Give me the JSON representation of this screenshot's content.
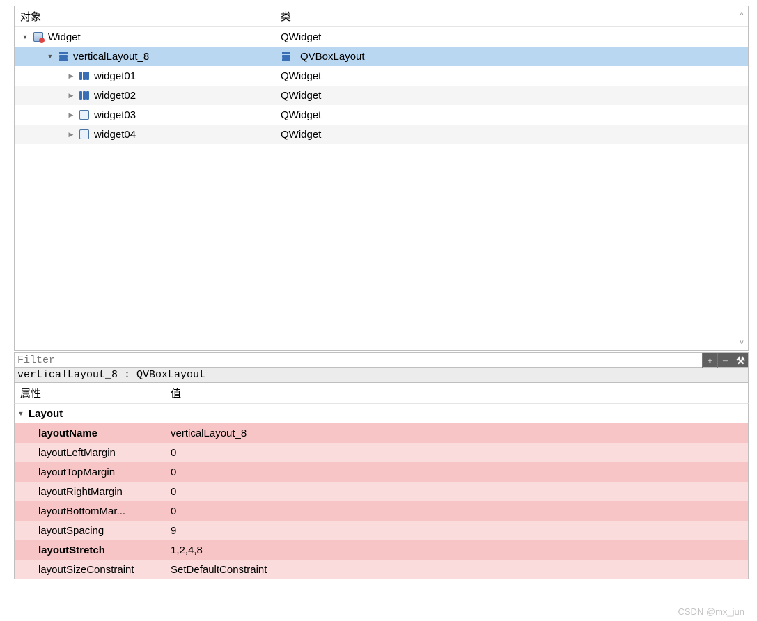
{
  "tree": {
    "headers": {
      "object": "对象",
      "class": "类"
    },
    "rows": [
      {
        "indent": 8,
        "exp": "open",
        "icon": "widget",
        "name": "Widget",
        "cls": "QWidget",
        "selected": false,
        "alt": false,
        "clsIcon": ""
      },
      {
        "indent": 44,
        "exp": "open",
        "icon": "vlayout",
        "name": "verticalLayout_8",
        "cls": "QVBoxLayout",
        "selected": true,
        "alt": false,
        "clsIcon": "vlayout"
      },
      {
        "indent": 74,
        "exp": "closed",
        "icon": "hstack",
        "name": "widget01",
        "cls": "QWidget",
        "selected": false,
        "alt": false,
        "clsIcon": ""
      },
      {
        "indent": 74,
        "exp": "closed",
        "icon": "hstack",
        "name": "widget02",
        "cls": "QWidget",
        "selected": false,
        "alt": true,
        "clsIcon": ""
      },
      {
        "indent": 74,
        "exp": "closed",
        "icon": "form",
        "name": "widget03",
        "cls": "QWidget",
        "selected": false,
        "alt": false,
        "clsIcon": ""
      },
      {
        "indent": 74,
        "exp": "closed",
        "icon": "form",
        "name": "widget04",
        "cls": "QWidget",
        "selected": false,
        "alt": true,
        "clsIcon": ""
      }
    ]
  },
  "filter": {
    "placeholder": "Filter"
  },
  "selection_label": "verticalLayout_8 : QVBoxLayout",
  "props": {
    "headers": {
      "name": "属性",
      "value": "值"
    },
    "group": "Layout",
    "rows": [
      {
        "name": "layoutName",
        "value": "verticalLayout_8",
        "bold": true,
        "shade": "pink"
      },
      {
        "name": "layoutLeftMargin",
        "value": "0",
        "bold": false,
        "shade": "pinklight"
      },
      {
        "name": "layoutTopMargin",
        "value": "0",
        "bold": false,
        "shade": "pink"
      },
      {
        "name": "layoutRightMargin",
        "value": "0",
        "bold": false,
        "shade": "pinklight"
      },
      {
        "name": "layoutBottomMar...",
        "value": "0",
        "bold": false,
        "shade": "pink"
      },
      {
        "name": "layoutSpacing",
        "value": "9",
        "bold": false,
        "shade": "pinklight"
      },
      {
        "name": "layoutStretch",
        "value": "1,2,4,8",
        "bold": true,
        "shade": "pink"
      },
      {
        "name": "layoutSizeConstraint",
        "value": "SetDefaultConstraint",
        "bold": false,
        "shade": "pinklight"
      }
    ]
  },
  "tools": {
    "plus": "+",
    "minus": "−",
    "wrench": "⚒"
  },
  "watermark": "CSDN @mx_jun"
}
